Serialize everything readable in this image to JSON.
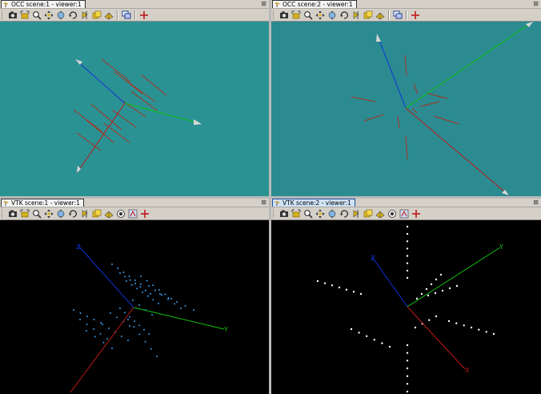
{
  "panes": [
    {
      "id": "occ1",
      "title": "OCC scene:1 - viewer:1",
      "active": false,
      "viewport_color": "#2b9294",
      "toolbar": [
        "dump-view",
        "fit-all",
        "zoom",
        "pan",
        "global-pan",
        "rotate",
        "front-view",
        "trihedron",
        "shading",
        "sep",
        "clone-view",
        "sep",
        "graduated-axes"
      ]
    },
    {
      "id": "occ2",
      "title": "OCC scene:2 - viewer:1",
      "active": false,
      "viewport_color": "#2b8b91",
      "toolbar": [
        "dump-view",
        "fit-all",
        "zoom",
        "pan",
        "global-pan",
        "rotate",
        "front-view",
        "trihedron",
        "shading",
        "sep",
        "clone-view",
        "sep",
        "graduated-axes"
      ]
    },
    {
      "id": "vtk1",
      "title": "VTK scene:1 - viewer:1",
      "active": false,
      "viewport_color": "#000000",
      "toolbar": [
        "dump-view",
        "fit-all",
        "zoom",
        "pan",
        "global-pan",
        "rotate",
        "front-view",
        "trihedron",
        "shading",
        "perspective",
        "rotation-point",
        "graduated-axes"
      ]
    },
    {
      "id": "vtk2",
      "title": "VTK scene:2 - viewer:1",
      "active": true,
      "viewport_color": "#000000",
      "toolbar": [
        "dump-view",
        "fit-all",
        "zoom",
        "pan",
        "global-pan",
        "rotate",
        "front-view",
        "trihedron",
        "shading",
        "perspective",
        "rotation-point",
        "graduated-axes"
      ]
    }
  ],
  "axis_labels": {
    "x": "X",
    "y": "Y",
    "z": "Z"
  },
  "close_glyph": "⊠",
  "colors": {
    "axis_x": "#c01818",
    "axis_y": "#10c010",
    "axis_z": "#1030d8",
    "occ_marks": "#a83222",
    "vtk1_points": "#3aa7ff",
    "vtk2_points": "#ffffff"
  }
}
